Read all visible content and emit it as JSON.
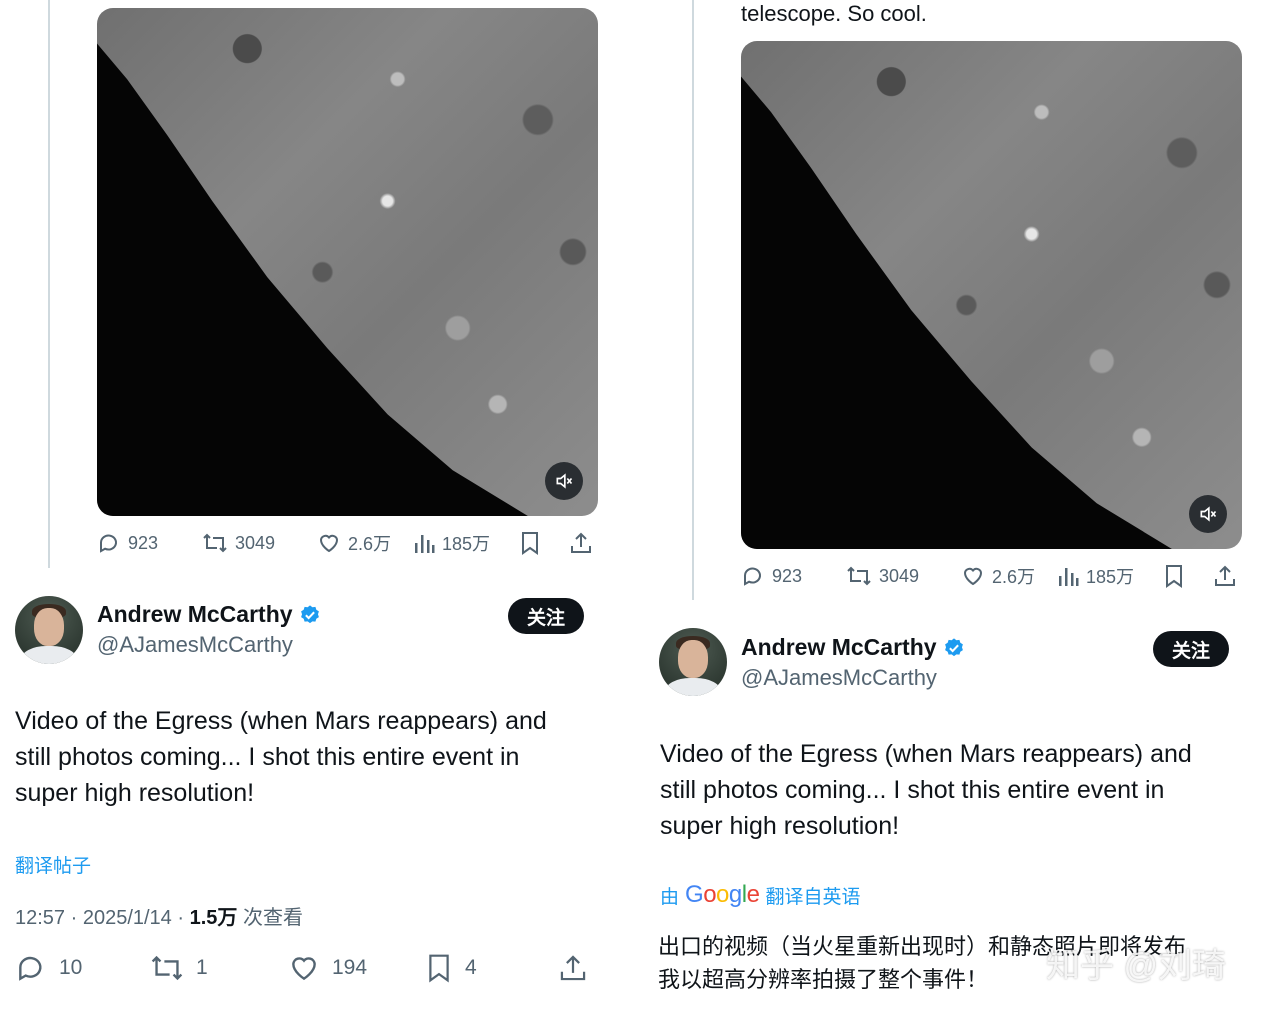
{
  "tweet": {
    "author_name": "Andrew McCarthy",
    "author_handle": "@AJamesMcCarthy",
    "follow_label": "关注",
    "text_lines": [
      "Video of the Egress (when Mars reappears) and",
      "still photos coming... I shot this entire event in",
      "super high resolution!"
    ],
    "translate_label": "翻译帖子",
    "time_date": "12:57 · 2025/1/14 · ",
    "views_count": "1.5万",
    "views_label": " 次查看",
    "replies": "10",
    "reposts": "1",
    "likes": "194",
    "bookmarks": "4"
  },
  "media_tweet": {
    "partial_text": "telescope. So cool.",
    "replies": "923",
    "reposts": "3049",
    "likes": "2.6万",
    "views": "185万"
  },
  "translation": {
    "by_label": "由",
    "google_letters": [
      "G",
      "o",
      "o",
      "g",
      "l",
      "e"
    ],
    "translated_from": "翻译自英语",
    "lines": [
      "出口的视频（当火星重新出现时）和静态照片即将发布",
      "我以超高分辨率拍摄了整个事件！"
    ]
  },
  "watermark": "知乎 @刘琦",
  "icons": {
    "reply": "reply-icon",
    "repost": "repost-icon",
    "like": "heart-icon",
    "views": "views-chart-icon",
    "bookmark": "bookmark-icon",
    "share": "share-icon",
    "mute": "muted-speaker-icon",
    "verified": "verified-badge-icon"
  },
  "colors": {
    "accent": "#1d9bf0",
    "text": "#0f1419",
    "secondary": "#536471",
    "google_blue": "#4285F4",
    "google_red": "#EA4335",
    "google_yellow": "#FBBC05",
    "google_green": "#34A853"
  }
}
